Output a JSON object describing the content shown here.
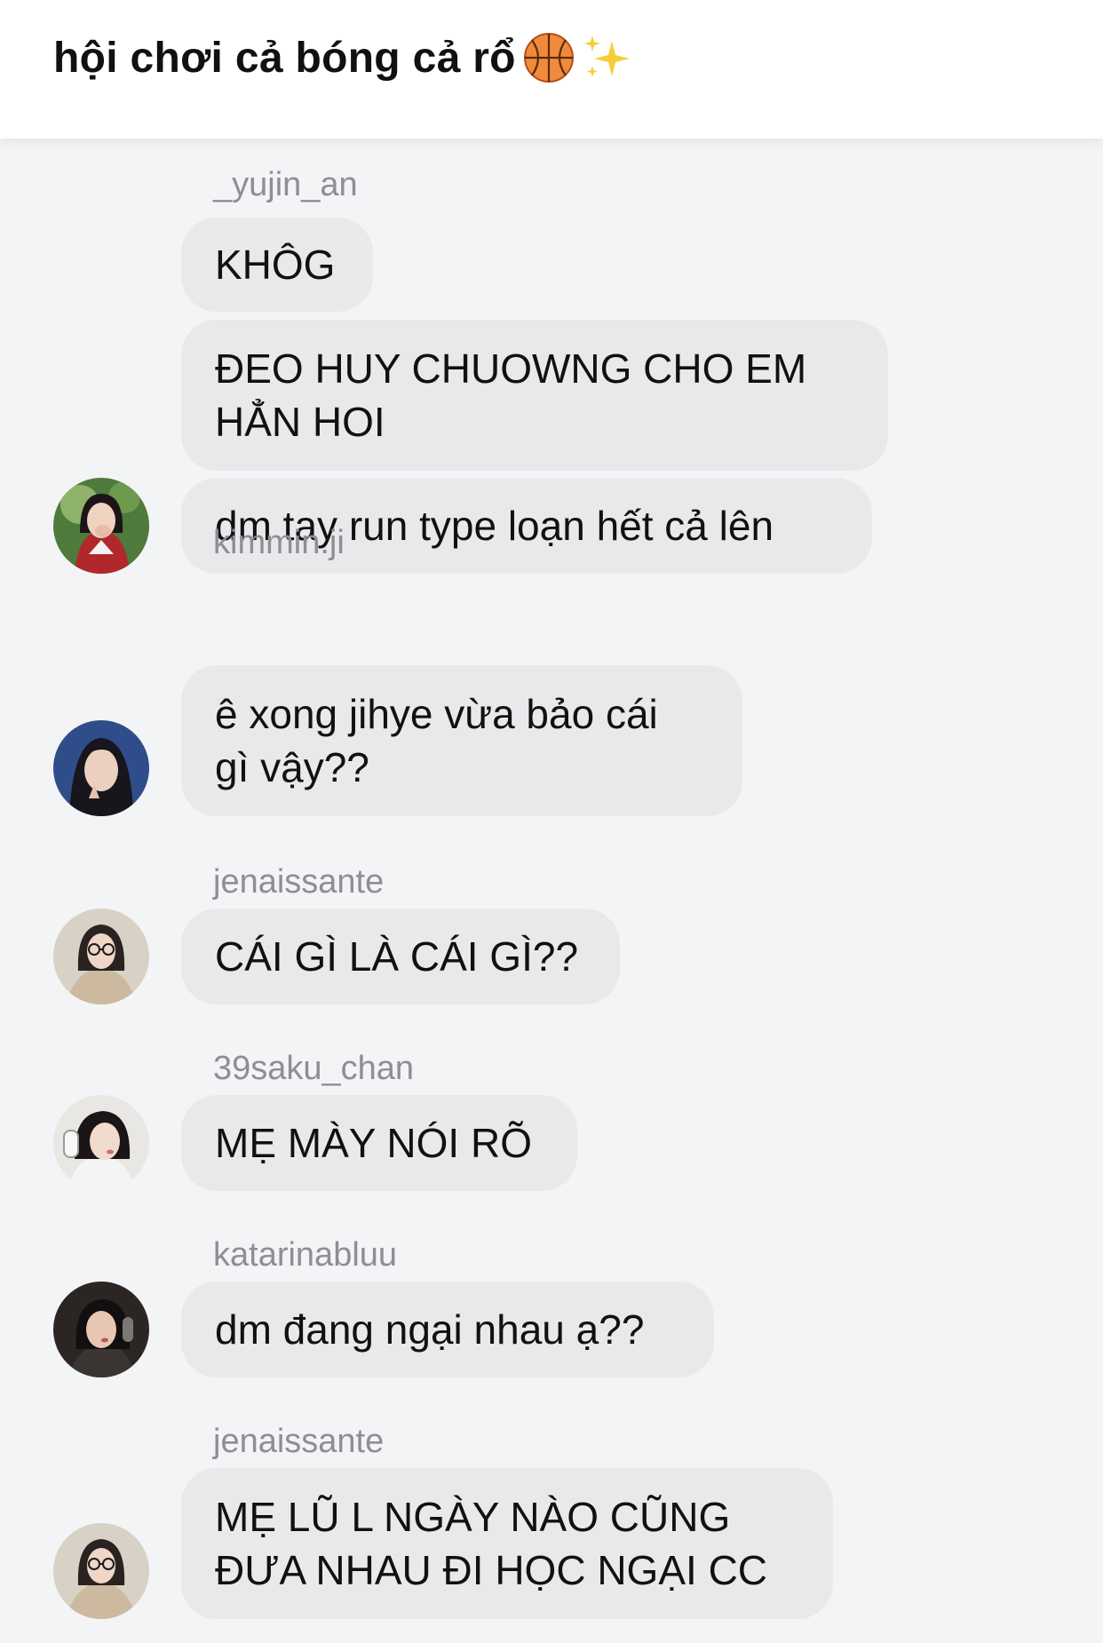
{
  "header": {
    "title": "hội chơi cả bóng cả rổ",
    "icons": [
      "basketball-icon",
      "sparkles-icon"
    ]
  },
  "messages": [
    {
      "sender": "_yujin_an",
      "bubbles": [
        "KHÔG",
        "ĐEO HUY CHUOWNG CHO EM\nHẲN HOI",
        "dm tay run type loạn hết cả lên"
      ]
    },
    {
      "sender": "kimmin.ji",
      "bubbles": [
        "ê xong jihye vừa bảo cái\ngì vậy??"
      ]
    },
    {
      "sender": "jenaissante",
      "bubbles": [
        "CÁI GÌ LÀ CÁI GÌ??"
      ]
    },
    {
      "sender": "39saku_chan",
      "bubbles": [
        "MẸ MÀY NÓI RÕ"
      ]
    },
    {
      "sender": "katarinabluu",
      "bubbles": [
        "dm đang ngại nhau ạ??"
      ]
    },
    {
      "sender": "jenaissante",
      "bubbles": [
        "MẸ LŨ L NGÀY NÀO CŨNG\nĐƯA NHAU ĐI HỌC NGẠI CC"
      ]
    }
  ],
  "colors": {
    "chat_background": "#f3f4f6",
    "bubble": "#e9e9ec",
    "sender_text": "#8e8e93",
    "message_text": "#111111"
  }
}
